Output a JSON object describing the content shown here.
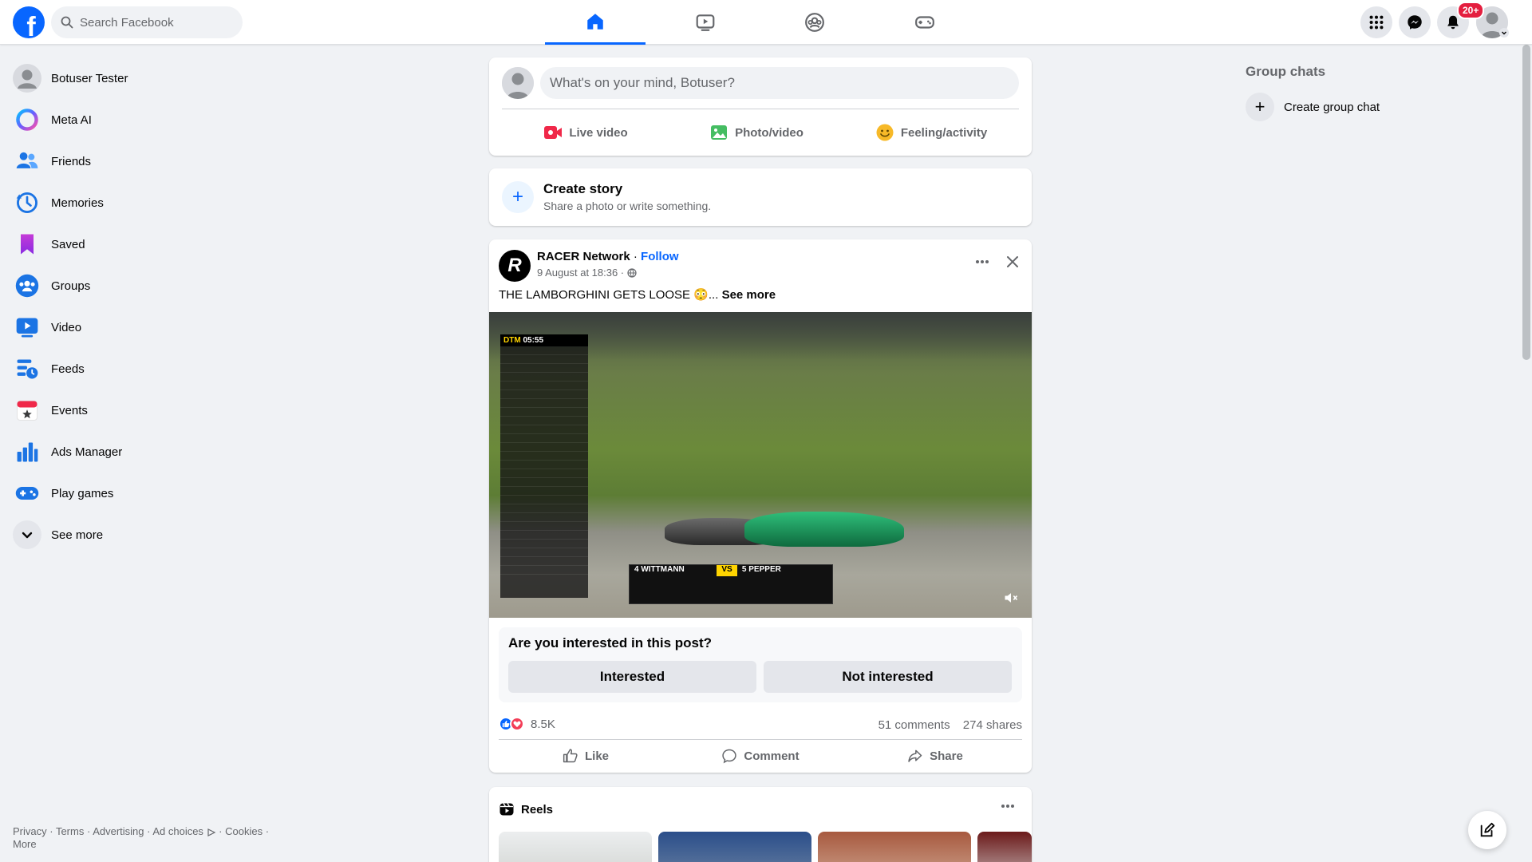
{
  "header": {
    "logo_letter": "f",
    "search_placeholder": "Search Facebook",
    "notifications_badge": "20+",
    "nav_tabs": [
      "home",
      "video",
      "groups",
      "gaming"
    ]
  },
  "sidebar": {
    "items": [
      {
        "label": "Botuser Tester",
        "icon": "avatar"
      },
      {
        "label": "Meta AI",
        "icon": "meta-ai-icon"
      },
      {
        "label": "Friends",
        "icon": "friends-icon"
      },
      {
        "label": "Memories",
        "icon": "memories-icon"
      },
      {
        "label": "Saved",
        "icon": "saved-icon"
      },
      {
        "label": "Groups",
        "icon": "groups-icon"
      },
      {
        "label": "Video",
        "icon": "video-icon"
      },
      {
        "label": "Feeds",
        "icon": "feeds-icon"
      },
      {
        "label": "Events",
        "icon": "events-icon"
      },
      {
        "label": "Ads Manager",
        "icon": "ads-manager-icon"
      },
      {
        "label": "Play games",
        "icon": "play-games-icon"
      },
      {
        "label": "See more",
        "icon": "chevron-down-icon"
      }
    ],
    "footer": {
      "privacy": "Privacy",
      "terms": "Terms",
      "advertising": "Advertising",
      "ad_choices": "Ad choices",
      "cookies": "Cookies",
      "more": "More"
    }
  },
  "composer": {
    "placeholder": "What's on your mind, Botuser?",
    "live_video": "Live video",
    "photo_video": "Photo/video",
    "feeling": "Feeling/activity"
  },
  "story": {
    "title": "Create story",
    "subtitle": "Share a photo or write something."
  },
  "post": {
    "author": "RACER Network",
    "separator": " · ",
    "follow": "Follow",
    "timestamp": "9 August at 18:36 ·",
    "text": "THE LAMBORGHINI GETS LOOSE 😳...",
    "see_more": "See more",
    "video": {
      "timer_label": "DTM",
      "timer": "05:55",
      "driver_left": "4 WITTMANN",
      "vs": "VS",
      "driver_right": "5 PEPPER"
    },
    "interest_question": "Are you interested in this post?",
    "interested": "Interested",
    "not_interested": "Not interested",
    "reaction_count": "8.5K",
    "comments": "51 comments",
    "shares": "274 shares",
    "like": "Like",
    "comment": "Comment",
    "share": "Share"
  },
  "reels": {
    "title": "Reels"
  },
  "right": {
    "group_chats_title": "Group chats",
    "create_group_chat": "Create group chat"
  },
  "colors": {
    "brand": "#0866ff",
    "badge": "#e41e3f",
    "page_bg": "#f0f2f5"
  }
}
